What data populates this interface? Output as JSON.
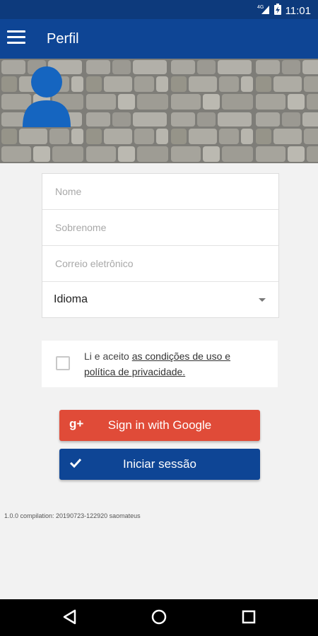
{
  "status_bar": {
    "network": "4G",
    "time": "11:01"
  },
  "app_bar": {
    "title": "Perfil",
    "menu_icon": "hamburger-menu-icon"
  },
  "form": {
    "first_name_placeholder": "Nome",
    "last_name_placeholder": "Sobrenome",
    "email_placeholder": "Correio eletrônico",
    "language_label": "Idioma"
  },
  "terms": {
    "prefix": "Li e aceito ",
    "link": "as condições de uso e política de privacidade."
  },
  "buttons": {
    "google": "Sign in with Google",
    "google_icon": "g+",
    "login": "Iniciar sessão"
  },
  "version": "1.0.0 compilation: 20190723-122920 saomateus",
  "colors": {
    "primary": "#0e4595",
    "status": "#0d3a7c",
    "google": "#e04b38"
  }
}
